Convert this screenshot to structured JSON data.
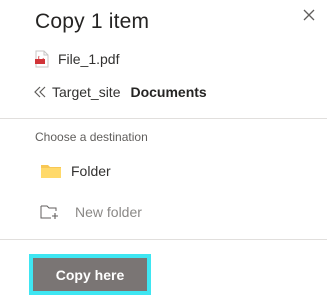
{
  "dialog": {
    "title": "Copy 1 item",
    "close_icon": "close-icon"
  },
  "file": {
    "name": "File_1.pdf",
    "icon": "pdf-file-icon",
    "icon_color": "#d13438"
  },
  "breadcrumb": {
    "back_icon": "double-chevron-left-icon",
    "parent": "Target_site",
    "current": "Documents"
  },
  "destination": {
    "label": "Choose a destination",
    "items": [
      {
        "label": "Folder",
        "icon": "folder-icon",
        "icon_color": "#f8c754"
      },
      {
        "label": "New folder",
        "icon": "new-folder-icon"
      }
    ]
  },
  "actions": {
    "copy_label": "Copy here",
    "highlight_color": "#3ee6f2",
    "button_color": "#7a7574"
  }
}
